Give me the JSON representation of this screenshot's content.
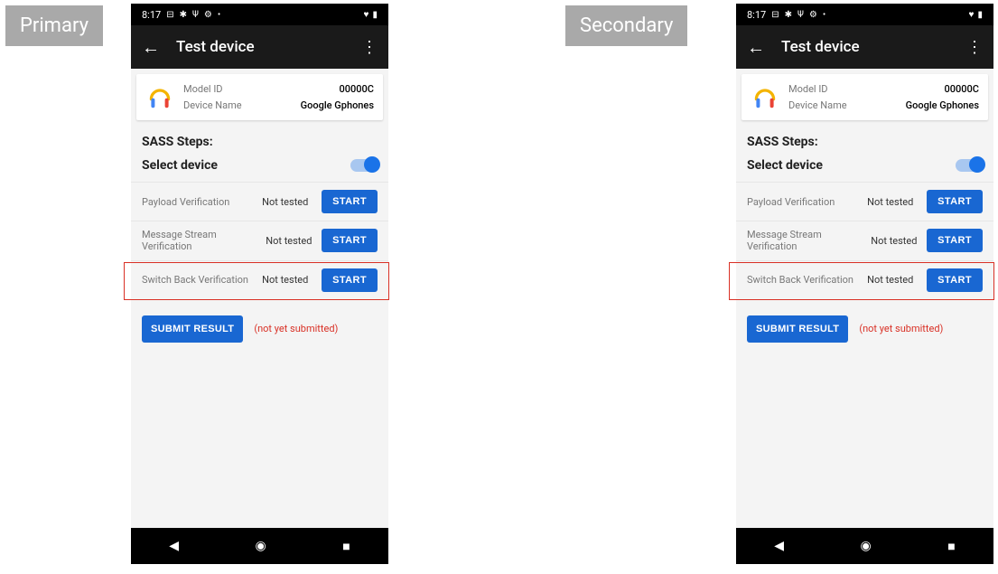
{
  "labels": {
    "primary": "Primary",
    "secondary": "Secondary"
  },
  "status": {
    "time": "8:17"
  },
  "appbar": {
    "title": "Test device"
  },
  "device_card": {
    "model_id_label": "Model ID",
    "model_id_value": "00000C",
    "device_name_label": "Device Name",
    "device_name_value": "Google Gphones"
  },
  "sass": {
    "heading": "SASS Steps:",
    "select_label": "Select device",
    "tests": [
      {
        "name": "Payload Verification",
        "status": "Not tested",
        "button": "START"
      },
      {
        "name": "Message Stream Verification",
        "status": "Not tested",
        "button": "START"
      },
      {
        "name": "Switch Back Verification",
        "status": "Not tested",
        "button": "START"
      }
    ],
    "submit_label": "SUBMIT RESULT",
    "submit_status": "(not yet submitted)"
  }
}
